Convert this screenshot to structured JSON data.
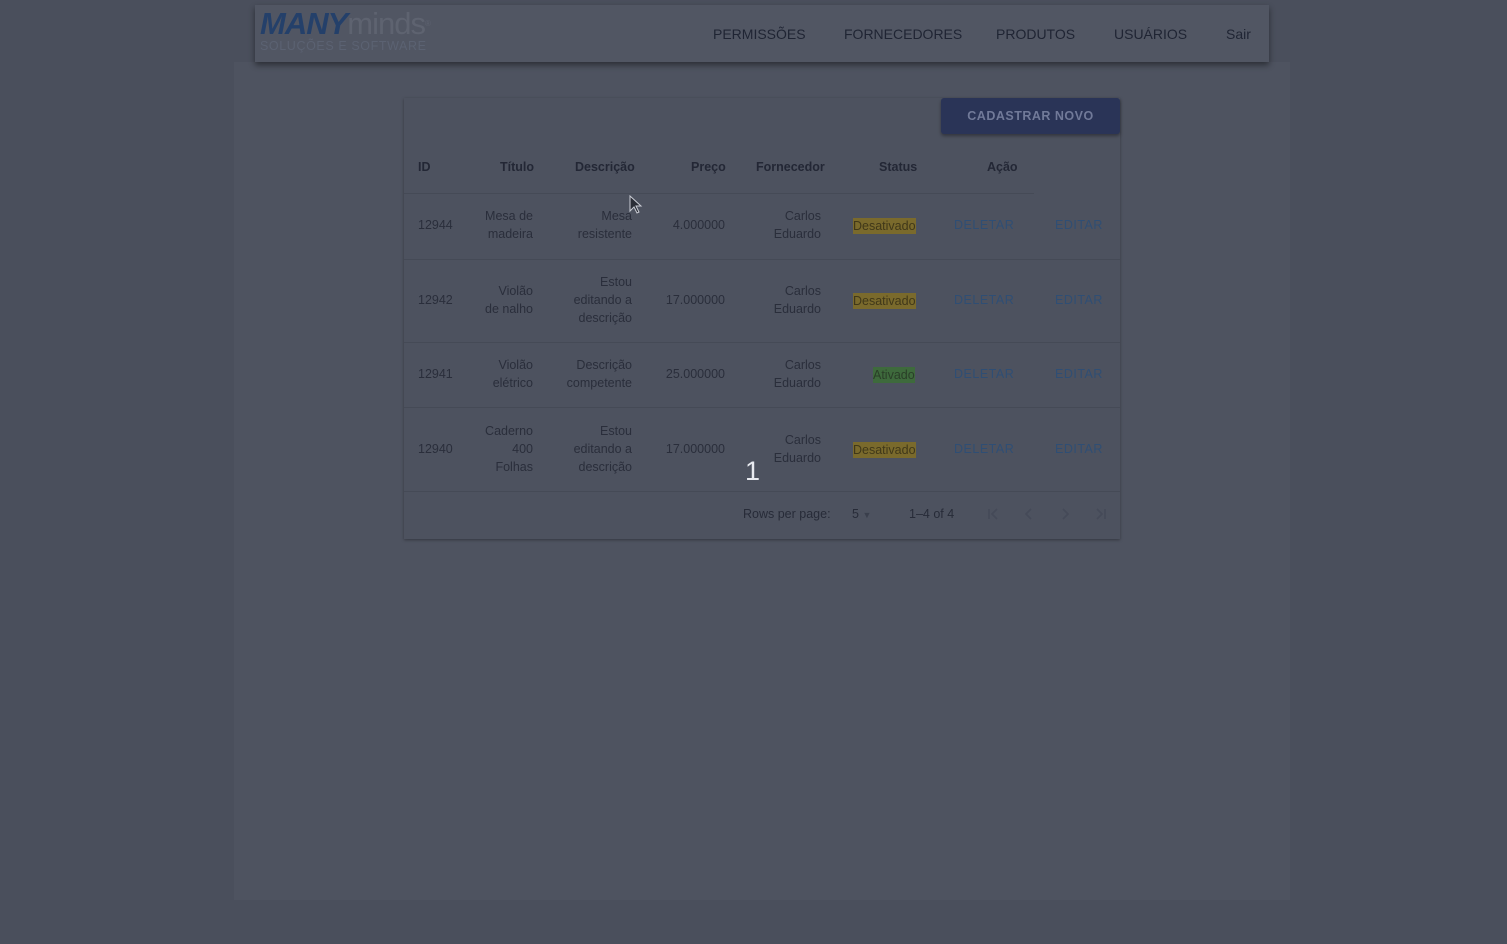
{
  "brand": {
    "logo_main_bold": "MANY",
    "logo_main_light": "minds",
    "logo_tm": "®",
    "logo_sub": "SOLUÇÕES E SOFTWARE"
  },
  "nav": {
    "permissoes": "PERMISSÕES",
    "fornecedores": "FORNECEDORES",
    "produtos": "PRODUTOS",
    "usuarios": "USUÁRIOS",
    "sair": "Sair"
  },
  "toolbar": {
    "new_label": "CADASTRAR NOVO"
  },
  "table": {
    "headers": {
      "id": "ID",
      "titulo": "Título",
      "descricao": "Descrição",
      "preco": "Preço",
      "fornecedor": "Fornecedor",
      "status": "Status",
      "acao": "Ação"
    },
    "rows": [
      {
        "id": "12944",
        "titulo": [
          "Mesa de",
          "madeira"
        ],
        "descricao": [
          "Mesa",
          "resistente"
        ],
        "preco": "4.000000",
        "fornecedor": [
          "Carlos",
          "Eduardo"
        ],
        "status": "Desativado",
        "delete": "DELETAR",
        "edit": "EDITAR"
      },
      {
        "id": "12942",
        "titulo": [
          "Violão",
          "de nalho"
        ],
        "descricao": [
          "Estou",
          "editando a",
          "descrição"
        ],
        "preco": "17.000000",
        "fornecedor": [
          "Carlos",
          "Eduardo"
        ],
        "status": "Desativado",
        "delete": "DELETAR",
        "edit": "EDITAR"
      },
      {
        "id": "12941",
        "titulo": [
          "Violão",
          "elétrico"
        ],
        "descricao": [
          "Descrição",
          "competente"
        ],
        "preco": "25.000000",
        "fornecedor": [
          "Carlos",
          "Eduardo"
        ],
        "status": "Ativado",
        "delete": "DELETAR",
        "edit": "EDITAR"
      },
      {
        "id": "12940",
        "titulo": [
          "Caderno",
          "400",
          "Folhas"
        ],
        "descricao": [
          "Estou",
          "editando a",
          "descrição"
        ],
        "preco": "17.000000",
        "fornecedor": [
          "Carlos",
          "Eduardo"
        ],
        "status": "Desativado",
        "delete": "DELETAR",
        "edit": "EDITAR"
      }
    ]
  },
  "pagination": {
    "rows_per_page_label": "Rows per page:",
    "rows_per_page_value": "5",
    "range": "1–4 of 4",
    "icons": [
      "first-page-icon",
      "prev-page-icon",
      "next-page-icon",
      "last-page-icon"
    ]
  },
  "overlay_number": "1",
  "colors": {
    "status_off": "#7a6a2c",
    "status_on": "#3e6a3c",
    "primary_button": "#2a3457",
    "action_link": "#2f4e74"
  }
}
